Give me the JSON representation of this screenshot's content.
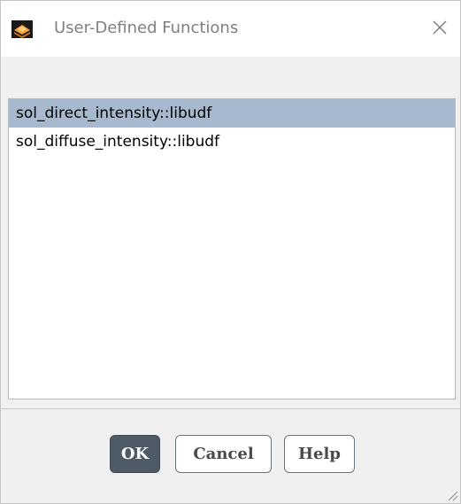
{
  "window": {
    "title": "User-Defined Functions",
    "app_icon": "fluent-logo-icon",
    "close_icon": "close-icon"
  },
  "functions_list": {
    "items": [
      {
        "label": "sol_direct_intensity::libudf",
        "selected": true
      },
      {
        "label": "sol_diffuse_intensity::libudf",
        "selected": false
      }
    ]
  },
  "buttons": {
    "ok_label": "OK",
    "cancel_label": "Cancel",
    "help_label": "Help"
  },
  "colors": {
    "selection": "#a7b9cf",
    "ok_background": "#4e5a66",
    "button_border": "#6b7480"
  }
}
